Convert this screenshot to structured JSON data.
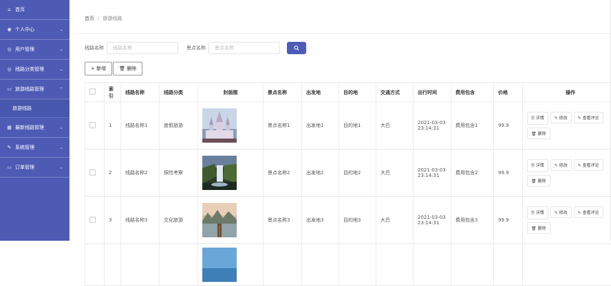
{
  "sidebar": {
    "items": [
      {
        "label": "首页",
        "icon": "home-icon",
        "glyph": "⌂",
        "chevron": ""
      },
      {
        "label": "个人中心",
        "icon": "user-icon",
        "glyph": "◉",
        "chevron": "⌄"
      },
      {
        "label": "用户管理",
        "icon": "users-icon",
        "glyph": "◎",
        "chevron": "⌄"
      },
      {
        "label": "线路分类管理",
        "icon": "category-icon",
        "glyph": "◎",
        "chevron": "⌄"
      },
      {
        "label": "旅游线路管理",
        "icon": "route-icon",
        "glyph": "▭",
        "chevron": "⌃"
      },
      {
        "label": "最新线路管理",
        "icon": "news-icon",
        "glyph": "▦",
        "chevron": "⌄"
      },
      {
        "label": "系统管理",
        "icon": "settings-icon",
        "glyph": "✎",
        "chevron": "⌄"
      },
      {
        "label": "订单管理",
        "icon": "order-icon",
        "glyph": "▭",
        "chevron": "⌄"
      }
    ],
    "submenu": {
      "label": "旅游线路"
    }
  },
  "breadcrumb": {
    "home": "首页",
    "separator": "/",
    "current": "旅游线路"
  },
  "search": {
    "route_label": "线路名称",
    "route_placeholder": "线路名称",
    "spot_label": "景点名称",
    "spot_placeholder": "景点名称"
  },
  "actions": {
    "add": "+ 新增",
    "delete": "🗑 删除"
  },
  "table": {
    "headers": [
      "",
      "索引",
      "线路名称",
      "线路分类",
      "封面图",
      "景点名称",
      "出发地",
      "目的地",
      "交通方式",
      "出行时间",
      "费用包含",
      "价格",
      "操作"
    ],
    "rows": [
      {
        "index": "1",
        "route": "线路名称1",
        "category": "度假旅游",
        "spot": "景点名称1",
        "from": "出发地1",
        "to": "目的地1",
        "transport": "大巴",
        "time": "2021-03-03 23:14:31",
        "fee": "费用包含1",
        "price": "99.9"
      },
      {
        "index": "2",
        "route": "线路名称2",
        "category": "探险考察",
        "spot": "景点名称2",
        "from": "出发地2",
        "to": "目的地2",
        "transport": "大巴",
        "time": "2021-03-03 23:14:31",
        "fee": "费用包含2",
        "price": "99.9"
      },
      {
        "index": "3",
        "route": "线路名称3",
        "category": "文化旅游",
        "spot": "景点名称3",
        "from": "出发地3",
        "to": "目的地3",
        "transport": "大巴",
        "time": "2021-03-03 23:14:31",
        "fee": "费用包含3",
        "price": "99.9"
      }
    ],
    "row_ops": {
      "detail": "🗎 详情",
      "edit": "✎ 修改",
      "review": "✎ 查看评论",
      "delete": "🗑 删除"
    }
  },
  "colors": {
    "sidebar": "#4e5bb5",
    "primary": "#4e5bb5"
  }
}
